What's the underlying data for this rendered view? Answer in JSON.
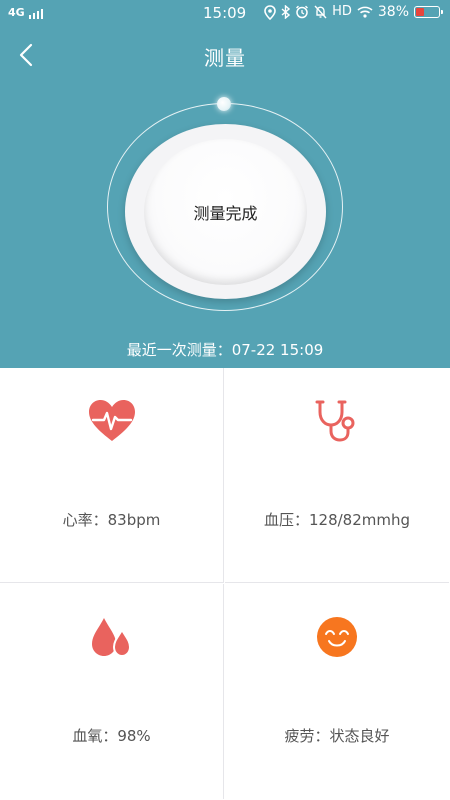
{
  "status_bar": {
    "network": "4G",
    "time": "15:09",
    "hd": "HD",
    "battery": "38%",
    "battery_level": 0.38,
    "icons": [
      "signal-icon",
      "location-icon",
      "bluetooth-icon",
      "alarm-icon",
      "mute-icon",
      "wifi-icon",
      "battery-icon"
    ]
  },
  "header": {
    "title": "测量",
    "back_icon": "back-arrow-icon"
  },
  "gauge": {
    "status": "测量完成"
  },
  "last_measurement": "最近一次测量：07-22 15:09",
  "metrics": [
    {
      "icon": "heart-rate-icon",
      "label": "心率：83bpm",
      "color": "#e9635e"
    },
    {
      "icon": "stethoscope-icon",
      "label": "血压：128/82mmhg",
      "color": "#e9635e"
    },
    {
      "icon": "blood-oxygen-icon",
      "label": "血氧：98%",
      "color": "#e9635e"
    },
    {
      "icon": "smiley-icon",
      "label": "疲劳：状态良好",
      "color": "#f7761f"
    }
  ],
  "colors": {
    "header_bg": "#55a3b4",
    "accent_red": "#e9635e",
    "accent_orange": "#f7761f"
  }
}
